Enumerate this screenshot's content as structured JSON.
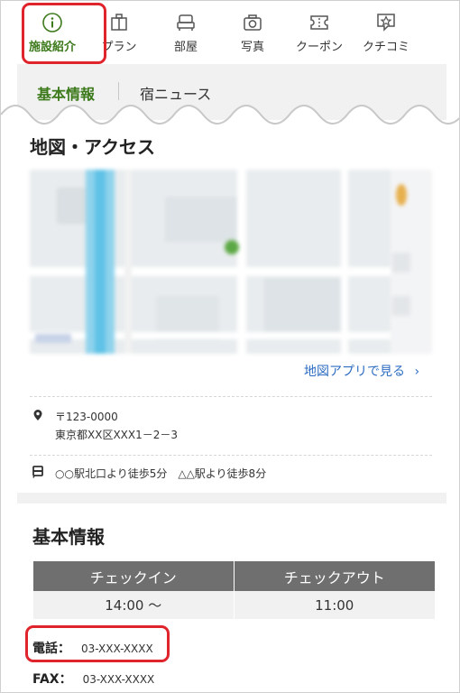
{
  "nav": {
    "items": [
      {
        "label": "施設紹介",
        "icon": "info-icon",
        "active": true
      },
      {
        "label": "プラン",
        "icon": "plan-icon",
        "active": false
      },
      {
        "label": "部屋",
        "icon": "bed-icon",
        "active": false
      },
      {
        "label": "写真",
        "icon": "camera-icon",
        "active": false
      },
      {
        "label": "クーポン",
        "icon": "coupon-icon",
        "active": false
      },
      {
        "label": "クチコミ",
        "icon": "review-icon",
        "active": false
      }
    ],
    "active_color": "#3d7a1c"
  },
  "subtabs": {
    "active": "基本情報",
    "other": "宿ニュース"
  },
  "access": {
    "title": "地図・アクセス",
    "map_link": "地図アプリで見る",
    "postal": "〒123-0000",
    "address": "東京都XX区XXX1－2－3",
    "station": "○○駅北口より徒歩5分　△△駅より徒歩8分"
  },
  "basic": {
    "title": "基本情報",
    "checkin_header": "チェックイン",
    "checkout_header": "チェックアウト",
    "checkin": "14:00 ～",
    "checkout": "11:00",
    "phone_label": "電話：",
    "phone": "03-XXX-XXXX",
    "fax_label": "FAX：",
    "fax": "03-XXX-XXXX"
  },
  "colors": {
    "highlight": "#e0242c",
    "link": "#2e6ec2"
  }
}
